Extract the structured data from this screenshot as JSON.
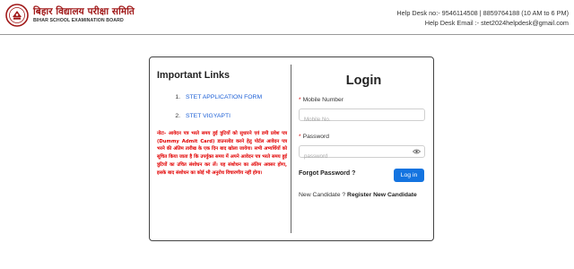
{
  "header": {
    "logo_hindi": "बिहार विद्यालय परीक्षा समिति",
    "logo_english": "BIHAR SCHOOL EXAMINATION BOARD",
    "helpdesk_no": "Help Desk no:- 9546114508 | 8859764188 (10 AM to 6 PM)",
    "helpdesk_email": "Help Desk Email :- stet2024helpdesk@gmail.com"
  },
  "links": {
    "title": "Important Links",
    "items": [
      {
        "num": "1.",
        "label": "STET APPLICATION FORM"
      },
      {
        "num": "2.",
        "label": "STET VIGYAPTI"
      }
    ],
    "notice": "नोटः- आवेदन पत्र भरते समय हुई त्रुटियों को सुधारने एवं डमी प्रवेश पत्र (Dummy Admit Card) डाउनलोड करने हेतु पोर्टल आवेदन पत्र भरने की अंतिम तारीख के एक दिन बाद खोला जायेगा। सभी अभ्यर्थियों को सूचित किया जाता है कि उपर्युक्त समय में अपने आवेदन पत्र भरते समय हुई त्रुटियों का उचित संशोधन कर लें। यह संशोधन का अंतिम अवसर होगा, इसके बाद संशोधन का कोई भी अनुरोध विचारणीय नहीं होगा।"
  },
  "login": {
    "title": "Login",
    "mobile_label": "Mobile Number",
    "mobile_placeholder": "Mobile No.",
    "password_label": "Password",
    "password_placeholder": "password",
    "forgot": "Forgot Password ?",
    "button": "Log in",
    "new_candidate_prefix": "New Candidate ? ",
    "register": "Register New Candidate"
  },
  "colors": {
    "brand_red": "#a01818",
    "notice_red": "#e20000",
    "link_blue": "#1c5fd6",
    "button_blue": "#1474e0"
  },
  "icons": [
    "bseb-emblem-icon",
    "eye-icon"
  ]
}
